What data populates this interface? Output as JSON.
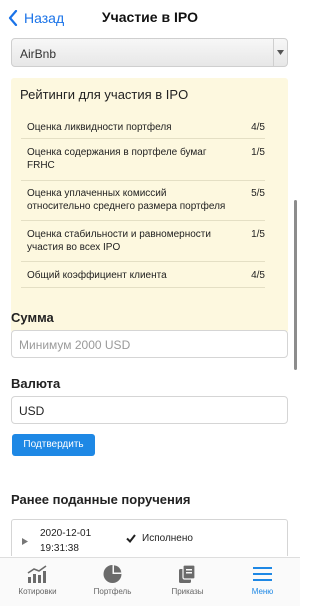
{
  "header": {
    "back_label": "Назад",
    "title": "Участие в IPO"
  },
  "instrument_select": {
    "selected": "AirBnb"
  },
  "ratings": {
    "title": "Рейтинги для участия в IPO",
    "rows": [
      {
        "label": "Оценка ликвидности портфеля",
        "value": "4/5"
      },
      {
        "label": "Оценка содержания в портфеле бумаг FRHC",
        "value": "1/5"
      },
      {
        "label": "Оценка уплаченных комиссий относительно среднего размера портфеля",
        "value": "5/5"
      },
      {
        "label": "Оценка стабильности и равномерности участия во всех IPO",
        "value": "1/5"
      },
      {
        "label": "Общий коэффициент клиента",
        "value": "4/5"
      }
    ]
  },
  "amount": {
    "label": "Сумма",
    "placeholder": "Минимум 2000 USD"
  },
  "currency": {
    "label": "Валюта",
    "value": "USD"
  },
  "confirm_label": "Подтвердить",
  "orders": {
    "title": "Ранее поданные поручения",
    "items": [
      {
        "date": "2020-12-01",
        "time": "19:31:38",
        "status": "Исполнено"
      }
    ]
  },
  "tabs": [
    {
      "label": "Котировки",
      "icon": "chart-bar-icon",
      "active": false
    },
    {
      "label": "Портфель",
      "icon": "pie-chart-icon",
      "active": false
    },
    {
      "label": "Приказы",
      "icon": "copy-icon",
      "active": false
    },
    {
      "label": "Меню",
      "icon": "menu-icon",
      "active": true
    }
  ],
  "colors": {
    "accent": "#1e88e5",
    "ratings_background": "#fdf8df"
  }
}
